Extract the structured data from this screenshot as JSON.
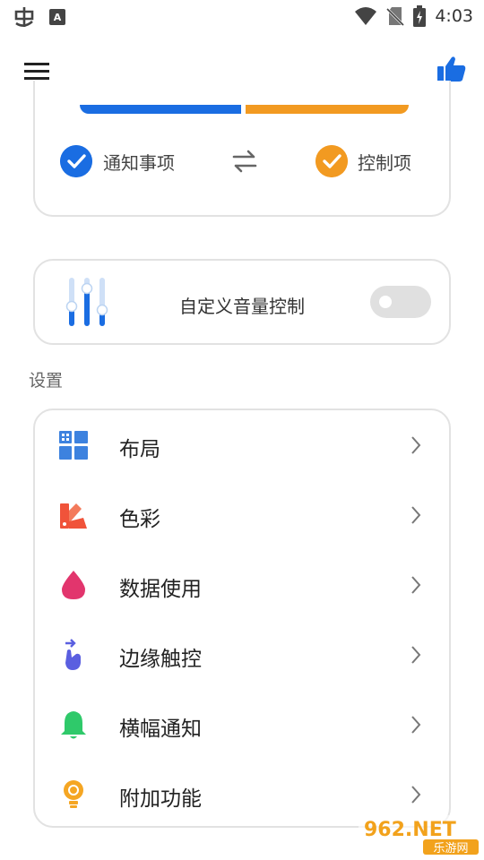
{
  "status_bar": {
    "time": "4:03"
  },
  "app_bar": {
    "menu_icon": "hamburger-menu-icon",
    "like_icon": "thumbs-up-icon"
  },
  "notification_card": {
    "left_label": "通知事项",
    "right_label": "控制项",
    "colors": {
      "blue": "#1a6de2",
      "orange": "#f29a21"
    }
  },
  "volume_card": {
    "label": "自定义音量控制",
    "toggle_on": false
  },
  "settings": {
    "section_title": "设置",
    "items": [
      {
        "label": "布局",
        "icon": "layout-grid-icon"
      },
      {
        "label": "色彩",
        "icon": "color-palette-icon"
      },
      {
        "label": "数据使用",
        "icon": "data-drop-icon"
      },
      {
        "label": "边缘触控",
        "icon": "edge-touch-icon"
      },
      {
        "label": "横幅通知",
        "icon": "bell-icon"
      },
      {
        "label": "附加功能",
        "icon": "lightbulb-icon"
      }
    ]
  },
  "watermark": {
    "top": "962.NET",
    "bottom": "乐游网"
  }
}
